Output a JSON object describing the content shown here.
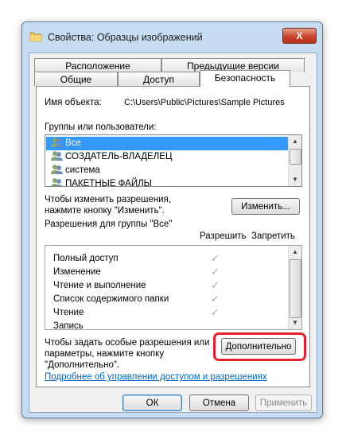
{
  "window": {
    "title": "Свойства: Образцы изображений",
    "close_label": "X"
  },
  "tabs": {
    "row1": [
      "Расположение",
      "Предыдущие версии"
    ],
    "row2": [
      "Общие",
      "Доступ",
      "Безопасность"
    ]
  },
  "object": {
    "label": "Имя объекта:",
    "value": "C:\\Users\\Public\\Pictures\\Sample Pictures"
  },
  "groups": {
    "label": "Группы или пользователи:",
    "items": [
      "Все",
      "СОЗДАТЕЛЬ-ВЛАДЕЛЕЦ",
      "система",
      "ПАКЕТНЫЕ ФАЙЛЫ"
    ]
  },
  "change": {
    "text1": "Чтобы изменить разрешения,",
    "text2": "нажмите кнопку \"Изменить\".",
    "button": "Изменить..."
  },
  "permissions": {
    "title": "Разрешения для группы \"Все\"",
    "allow": "Разрешить",
    "deny": "Запретить",
    "rows": [
      "Полный доступ",
      "Изменение",
      "Чтение и выполнение",
      "Список содержимого папки",
      "Чтение",
      "Запись"
    ],
    "check_glyph": "✓"
  },
  "advanced": {
    "text1": "Чтобы задать особые разрешения или",
    "text2": "параметры, нажмите кнопку",
    "text3": "\"Дополнительно\".",
    "button": "Дополнительно"
  },
  "help_link": "Подробнее об управлении доступом и разрешениях",
  "footer": {
    "ok": "ОК",
    "cancel": "Отмена",
    "apply": "Применить"
  },
  "colors": {
    "selection": "#3399ff",
    "highlight": "#e8212d",
    "link": "#0066cc"
  }
}
